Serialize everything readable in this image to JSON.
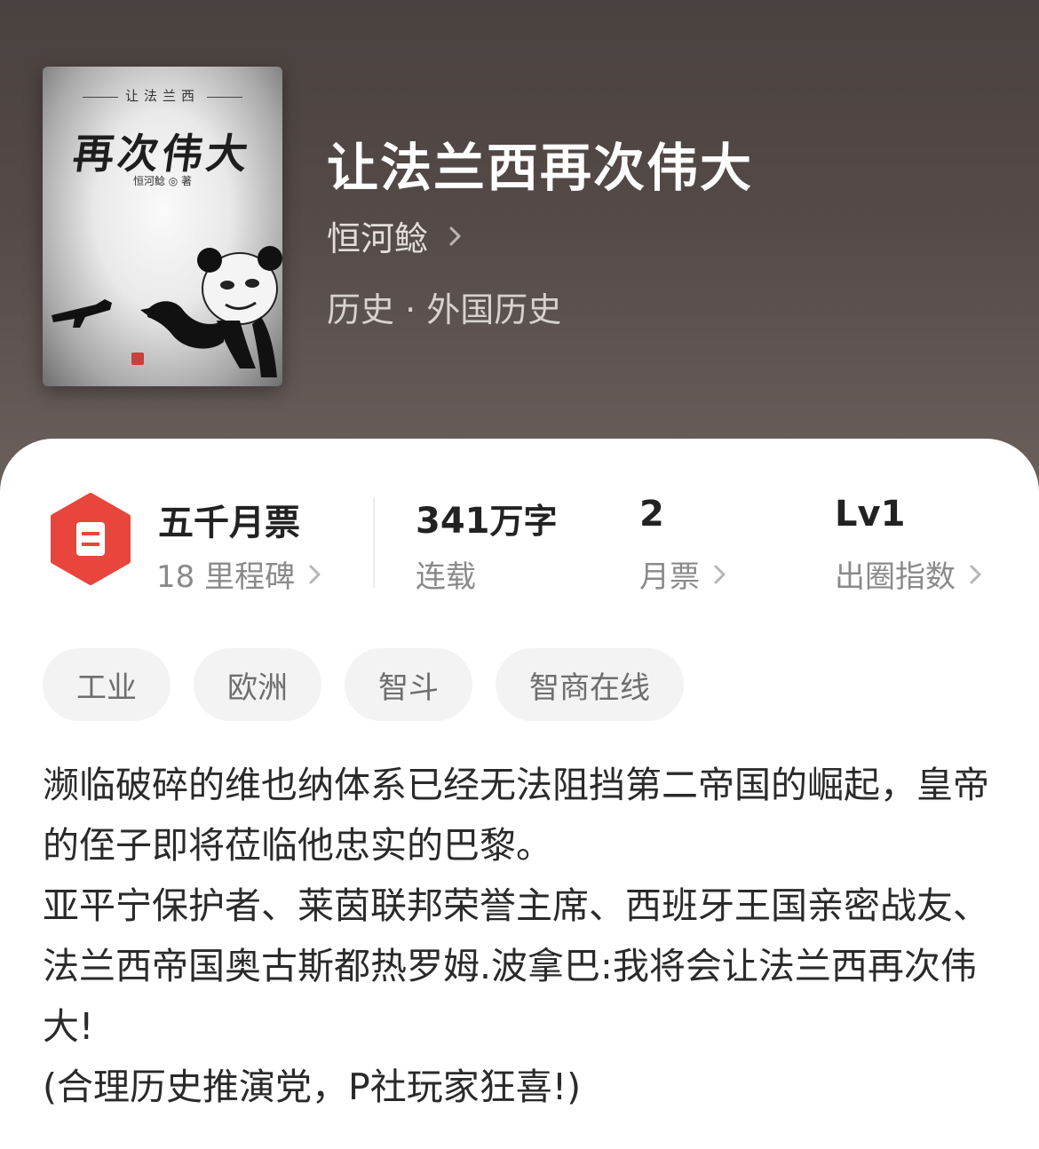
{
  "book": {
    "title": "让法兰西再次伟大",
    "author": "恒河鲶",
    "genre": "历史 · 外国历史"
  },
  "cover": {
    "series": "让法兰西",
    "title": "再次伟大",
    "author_line": "恒河鲶 ◎ 著"
  },
  "stats": {
    "milestone": {
      "title": "五千月票",
      "sub": "18 里程碑"
    },
    "words": {
      "value": "341",
      "unit": "万字",
      "label": "连载"
    },
    "monthly_tickets": {
      "value": "2",
      "label": "月票"
    },
    "influence": {
      "value": "Lv1",
      "label": "出圈指数"
    }
  },
  "tags": [
    "工业",
    "欧洲",
    "智斗",
    "智商在线"
  ],
  "description": [
    "濒临破碎的维也纳体系已经无法阻挡第二帝国的崛起，皇帝的侄子即将莅临他忠实的巴黎。",
    "亚平宁保护者、莱茵联邦荣誉主席、西班牙王国亲密战友、法兰西帝国奥古斯都热罗姆.波拿巴:我将会让法兰西再次伟大!",
    "(合理历史推演党，P社玩家狂喜!)"
  ],
  "colors": {
    "header_bg": "#4d4442",
    "accent_red": "#e8453c",
    "tag_bg": "#f3f3f3"
  },
  "icons": {
    "ticket": "ticket-icon",
    "chevron": "chevron-right-icon"
  }
}
